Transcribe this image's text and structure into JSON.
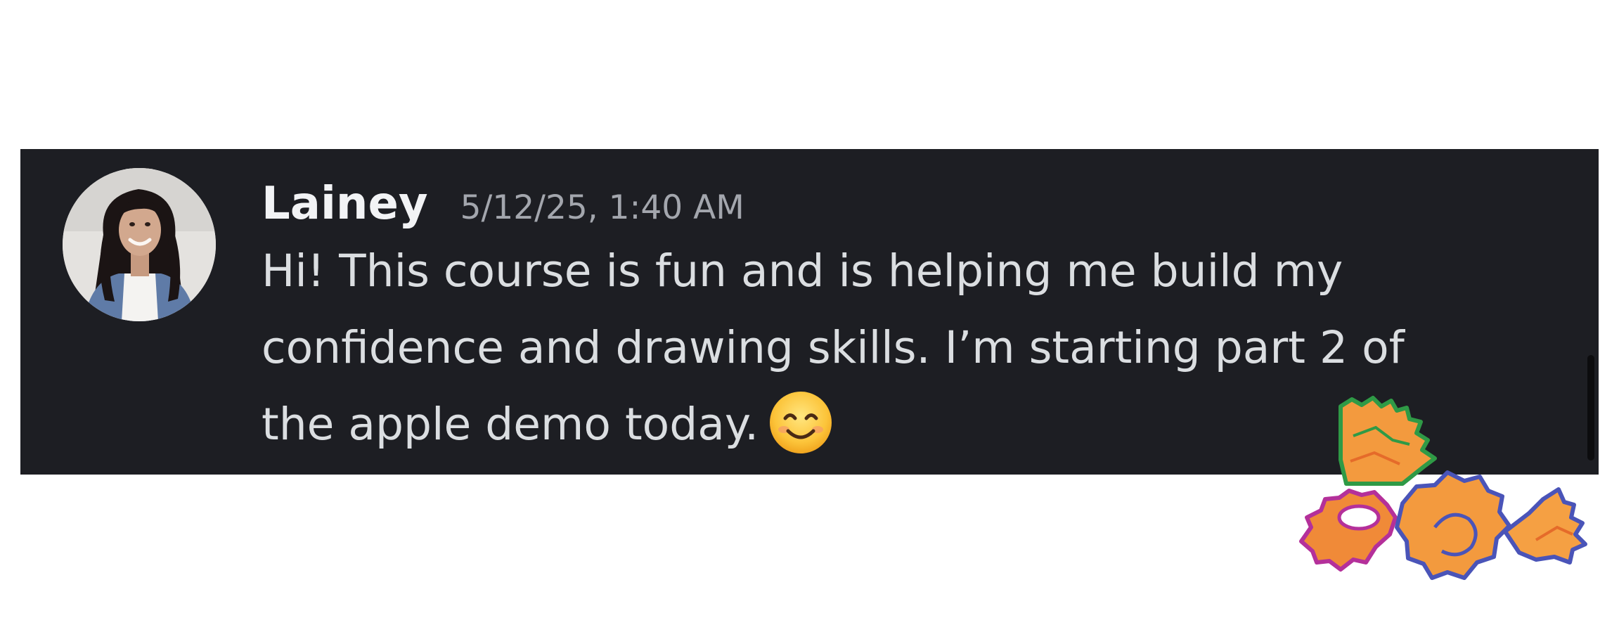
{
  "message": {
    "author": "Lainey",
    "timestamp": "5/12/25, 1:40 AM",
    "lines": [
      "Hi! This course is fun and is helping me build my",
      "confidence and drawing skills. I’m starting part 2 of",
      "the apple demo today."
    ],
    "emoji": "smiling-face-with-smiling-eyes"
  },
  "decoration": {
    "icon": "pencil-shavings"
  },
  "colors": {
    "card_background": "#1d1e23",
    "author_text": "#f2f3f5",
    "timestamp_text": "#a3a6ad",
    "message_text": "#dbdee1",
    "page_background": "#ffffff"
  }
}
